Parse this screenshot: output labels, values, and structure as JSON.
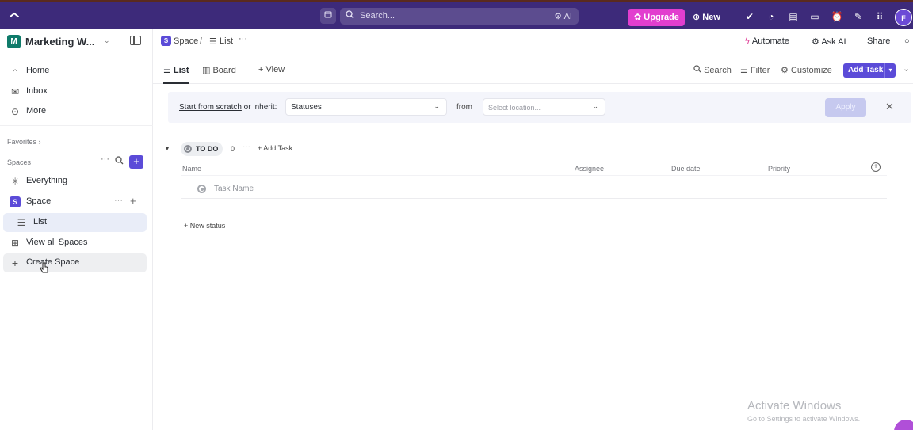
{
  "topbar": {
    "search_placeholder": "Search...",
    "ai_label": "AI",
    "upgrade_label": "Upgrade",
    "new_label": "New",
    "avatar_initial": "F"
  },
  "sidebar": {
    "workspace_initial": "M",
    "workspace_name": "Marketing W...",
    "nav": [
      {
        "label": "Home",
        "icon": "home-icon"
      },
      {
        "label": "Inbox",
        "icon": "inbox-icon"
      },
      {
        "label": "More",
        "icon": "more-icon"
      }
    ],
    "favorites_label": "Favorites",
    "spaces_label": "Spaces",
    "everything_label": "Everything",
    "space_initial": "S",
    "space_name": "Space",
    "list_label": "List",
    "view_all_label": "View all Spaces",
    "create_space_label": "Create Space"
  },
  "header": {
    "breadcrumb_space_initial": "S",
    "breadcrumb_space": "Space",
    "breadcrumb_sep": "/",
    "breadcrumb_list": "List",
    "automate_label": "Automate",
    "ask_ai_label": "Ask AI",
    "share_label": "Share"
  },
  "views": {
    "tabs": [
      {
        "label": "List",
        "active": true
      },
      {
        "label": "Board",
        "active": false
      }
    ],
    "add_view_label": "View",
    "search_label": "Search",
    "filter_label": "Filter",
    "customize_label": "Customize",
    "add_task_label": "Add Task"
  },
  "template_bar": {
    "start_link": "Start from scratch",
    "lead_rest": " or inherit:",
    "statuses_value": "Statuses",
    "from_label": "from",
    "location_placeholder": "Select location...",
    "apply_label": "Apply"
  },
  "group": {
    "status_label": "TO DO",
    "count": "0",
    "add_task_label": "Add Task",
    "columns": [
      "Name",
      "Assignee",
      "Due date",
      "Priority"
    ],
    "task_placeholder": "Task Name",
    "new_status_label": "New status"
  },
  "watermark": {
    "title": "Activate Windows",
    "subtitle": "Go to Settings to activate Windows."
  },
  "colors": {
    "topbar": "#3d2a7a",
    "accent": "#5b4bd8",
    "upgrade": "#e23ecf",
    "workspace_badge": "#0f7b6a"
  }
}
